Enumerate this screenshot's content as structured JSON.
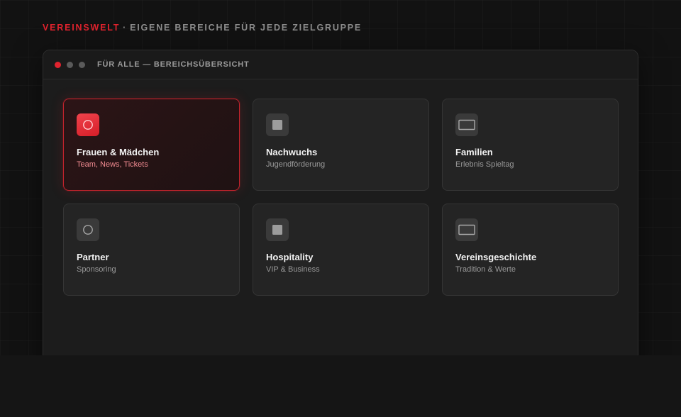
{
  "header": {
    "brand": "VEREINSWELT",
    "separator": "·",
    "tagline": "EIGENE BEREICHE FÜR JEDE ZIELGRUPPE"
  },
  "window": {
    "title": "FÜR ALLE — BEREICHSÜBERSICHT",
    "controls": [
      "close",
      "minimize",
      "maximize"
    ]
  },
  "cards": [
    {
      "title": "Frauen & Mädchen",
      "subtitle": "Team, News, Tickets",
      "icon": "circle-icon",
      "active": true
    },
    {
      "title": "Nachwuchs",
      "subtitle": "Jugendförderung",
      "icon": "square-icon",
      "active": false
    },
    {
      "title": "Familien",
      "subtitle": "Erlebnis Spieltag",
      "icon": "rectangle-icon",
      "active": false
    },
    {
      "title": "Partner",
      "subtitle": "Sponsoring",
      "icon": "circle-icon",
      "active": false
    },
    {
      "title": "Hospitality",
      "subtitle": "VIP & Business",
      "icon": "square-icon",
      "active": false
    },
    {
      "title": "Vereinsgeschichte",
      "subtitle": "Tradition & Werte",
      "icon": "rectangle-icon",
      "active": false
    }
  ],
  "colors": {
    "accent": "#e0232e",
    "background": "#121212",
    "card": "#242424",
    "active_card_border": "#c0232c"
  }
}
